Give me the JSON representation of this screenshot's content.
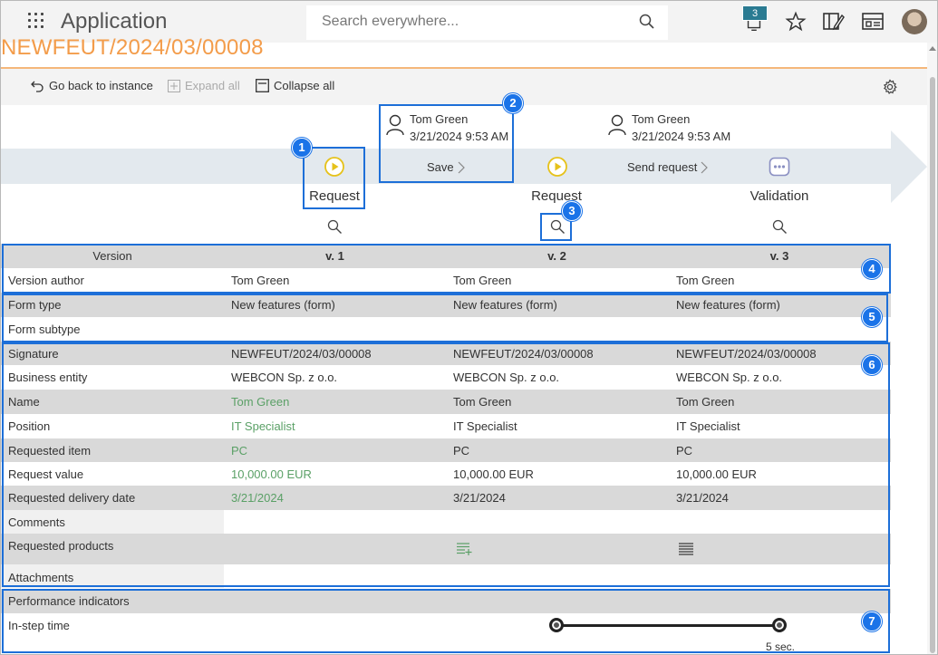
{
  "header": {
    "app_title": "Application",
    "search_placeholder": "Search everywhere...",
    "notification_count": "3"
  },
  "document": {
    "title": "NEWFEUT/2024/03/00008"
  },
  "toolbar": {
    "go_back": "Go back to instance",
    "expand_all": "Expand all",
    "collapse_all": "Collapse all"
  },
  "path": {
    "steps": [
      {
        "label": "Request",
        "icon": "play-circle-icon"
      },
      {
        "label": "Request",
        "icon": "play-circle-icon"
      },
      {
        "label": "Validation",
        "icon": "ellipsis-icon"
      }
    ],
    "transitions": [
      {
        "author": "Tom Green",
        "date": "3/21/2024 9:53 AM",
        "action": "Save"
      },
      {
        "author": "Tom Green",
        "date": "3/21/2024 9:53 AM",
        "action": "Send request"
      }
    ]
  },
  "versions": {
    "header_label": "Version",
    "columns": [
      "v. 1",
      "v. 2",
      "v. 3"
    ]
  },
  "rows": [
    {
      "label": "Version author",
      "values": [
        "Tom Green",
        "Tom Green",
        "Tom Green"
      ]
    },
    {
      "label": "Form type",
      "values": [
        "New features (form)",
        "New features (form)",
        "New features (form)"
      ]
    },
    {
      "label": "Form subtype",
      "values": [
        "",
        "",
        ""
      ]
    },
    {
      "label": "Signature",
      "values": [
        "NEWFEUT/2024/03/00008",
        "NEWFEUT/2024/03/00008",
        "NEWFEUT/2024/03/00008"
      ]
    },
    {
      "label": "Business entity",
      "values": [
        "WEBCON Sp. z o.o.",
        "WEBCON Sp. z o.o.",
        "WEBCON Sp. z o.o."
      ]
    },
    {
      "label": "Name",
      "values": [
        "Tom Green",
        "Tom Green",
        "Tom Green"
      ]
    },
    {
      "label": "Position",
      "values": [
        "IT Specialist",
        "IT Specialist",
        "IT Specialist"
      ]
    },
    {
      "label": "Requested item",
      "values": [
        "PC",
        "PC",
        "PC"
      ]
    },
    {
      "label": "Request value",
      "values": [
        "10,000.00 EUR",
        "10,000.00 EUR",
        "10,000.00 EUR"
      ]
    },
    {
      "label": "Requested delivery date",
      "values": [
        "3/21/2024",
        "3/21/2024",
        "3/21/2024"
      ]
    },
    {
      "label": "Comments",
      "values": [
        "",
        "",
        ""
      ]
    },
    {
      "label": "Requested products",
      "values": [
        "",
        "",
        ""
      ]
    },
    {
      "label": "Attachments",
      "values": [
        "",
        "",
        ""
      ]
    }
  ],
  "performance": {
    "section_label": "Performance indicators",
    "in_step_label": "In-step time",
    "in_step_value": "5 sec."
  },
  "annotations": [
    "1",
    "2",
    "3",
    "4",
    "5",
    "6",
    "7"
  ],
  "colors": {
    "accent_orange": "#f39c4a",
    "annotation_blue": "#1a73e8",
    "changed_value_green": "#5aa066",
    "path_band": "#e3e9ee"
  }
}
